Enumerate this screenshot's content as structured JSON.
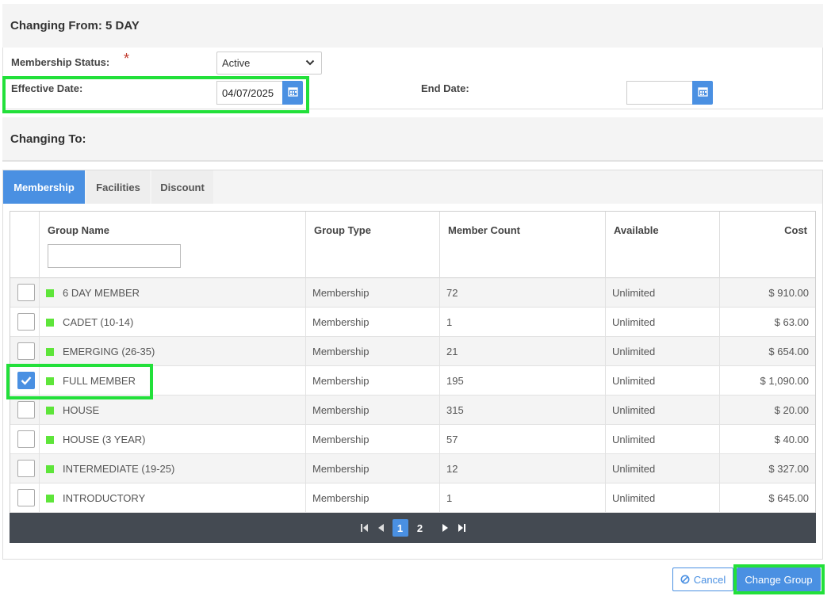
{
  "changing_from": {
    "title": "Changing From: 5 DAY"
  },
  "form": {
    "membership_status_label": "Membership Status:",
    "required_mark": "*",
    "membership_status_value": "Active",
    "effective_date_label": "Effective Date:",
    "effective_date_value": "04/07/2025",
    "end_date_label": "End Date:",
    "end_date_value": ""
  },
  "changing_to": {
    "title": "Changing To:"
  },
  "tabs": [
    {
      "label": "Membership",
      "active": true
    },
    {
      "label": "Facilities",
      "active": false
    },
    {
      "label": "Discount",
      "active": false
    }
  ],
  "grid": {
    "columns": [
      "Group Name",
      "Group Type",
      "Member Count",
      "Available",
      "Cost"
    ],
    "filter_value": "",
    "rows": [
      {
        "checked": false,
        "name": "6 DAY MEMBER",
        "type": "Membership",
        "count": "72",
        "available": "Unlimited",
        "cost": "$ 910.00"
      },
      {
        "checked": false,
        "name": "CADET (10-14)",
        "type": "Membership",
        "count": "1",
        "available": "Unlimited",
        "cost": "$ 63.00"
      },
      {
        "checked": false,
        "name": "EMERGING (26-35)",
        "type": "Membership",
        "count": "21",
        "available": "Unlimited",
        "cost": "$ 654.00"
      },
      {
        "checked": true,
        "name": "FULL MEMBER",
        "type": "Membership",
        "count": "195",
        "available": "Unlimited",
        "cost": "$ 1,090.00"
      },
      {
        "checked": false,
        "name": "HOUSE",
        "type": "Membership",
        "count": "315",
        "available": "Unlimited",
        "cost": "$ 20.00"
      },
      {
        "checked": false,
        "name": "HOUSE (3 YEAR)",
        "type": "Membership",
        "count": "57",
        "available": "Unlimited",
        "cost": "$ 40.00"
      },
      {
        "checked": false,
        "name": "INTERMEDIATE (19-25)",
        "type": "Membership",
        "count": "12",
        "available": "Unlimited",
        "cost": "$ 327.00"
      },
      {
        "checked": false,
        "name": "INTRODUCTORY",
        "type": "Membership",
        "count": "1",
        "available": "Unlimited",
        "cost": "$ 645.00"
      }
    ]
  },
  "pager": {
    "pages": [
      "1",
      "2"
    ],
    "current": "1"
  },
  "actions": {
    "cancel_label": "Cancel",
    "change_label": "Change Group"
  },
  "colors": {
    "accent": "#4a90e2",
    "highlight": "#22e03a",
    "status_dot": "#5ee53a",
    "pager_bg": "#444a52"
  },
  "icons": [
    "calendar-icon",
    "chevron-down-icon",
    "checkmark-icon",
    "first-page-icon",
    "prev-page-icon",
    "next-page-icon",
    "last-page-icon",
    "cancel-icon"
  ]
}
